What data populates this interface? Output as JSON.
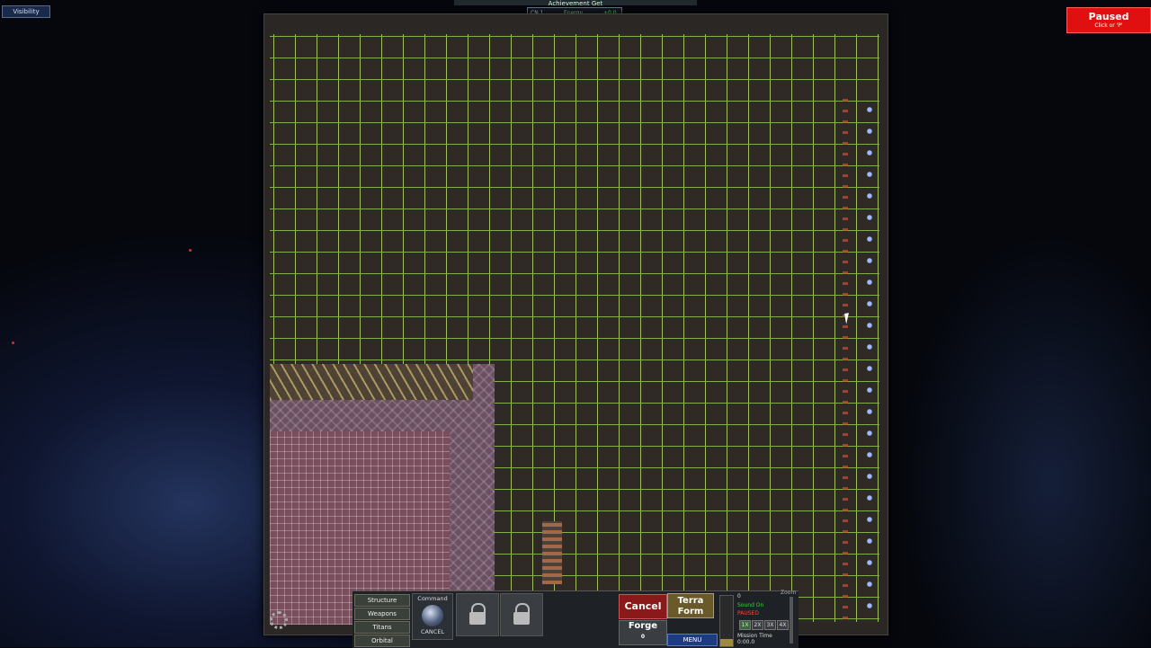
{
  "top_left": {
    "visibility_label": "Visibility"
  },
  "pause_button": {
    "title": "Paused",
    "hint": "Click or 'P'"
  },
  "hud": {
    "title": "Achievement Get",
    "col1": "CN 1",
    "col2": "Energy",
    "col3": "+0.0",
    "val1": "0",
    "val2": "0"
  },
  "build_menu": {
    "categories": [
      "Structure",
      "Weapons",
      "Titans",
      "Orbital"
    ],
    "command_label": "Command",
    "command_cancel": "CANCEL"
  },
  "actions": {
    "cancel": "Cancel",
    "terra_line1": "Terra",
    "terra_line2": "Form",
    "forge": "Forge",
    "forge_count": "0",
    "menu": "MENU"
  },
  "status": {
    "counter": "0",
    "sound": "Sound On",
    "paused": "PAUSED",
    "speeds": [
      "1X",
      "2X",
      "3X",
      "4X"
    ],
    "mission_time_label": "Mission Time",
    "mission_time": "0:00.0",
    "zoom_label": "Zoom"
  },
  "slider_level": 0.15
}
